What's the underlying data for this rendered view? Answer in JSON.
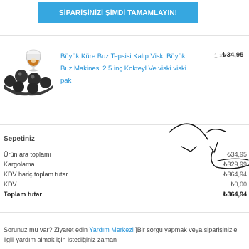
{
  "cta": {
    "label": "SİPARİŞİNİZİ ŞİMDİ TAMAMLAYIN!"
  },
  "product": {
    "name": "Büyük Küre Buz Tepsisi Kalıp Viski Büyük Buz Makinesi 2.5 inç Kokteyl Ve viski viski pak",
    "qty": "1 ×",
    "price": "₺34,95"
  },
  "summary": {
    "title": "Sepetiniz",
    "rows": [
      {
        "label": "Ürün ara toplamı",
        "value": "₺34,95"
      },
      {
        "label": "Kargolama",
        "value": "₺329,99"
      },
      {
        "label": "KDV hariç toplam tutar",
        "value": "₺364,94"
      },
      {
        "label": "KDV",
        "value": "₺0,00"
      },
      {
        "label": "Toplam tutar",
        "value": "₺364,94"
      }
    ]
  },
  "help": {
    "before": "Sorunuz mu var? Ziyaret edin ",
    "link": "Yardım Merkezi",
    "after": " ]Bir sorgu yapmak veya siparişinizle ilgili yardım almak için istediğiniz zaman"
  },
  "colors": {
    "cta": "#36a7e0",
    "link": "#1e8fd6",
    "annotation": "#111111"
  }
}
